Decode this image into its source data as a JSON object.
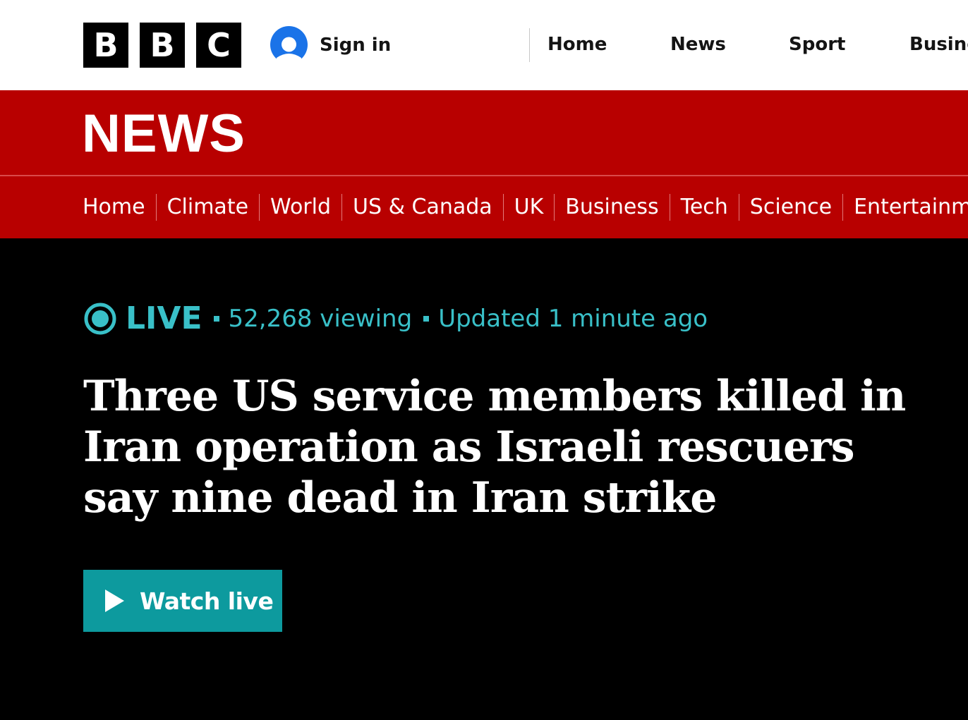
{
  "brand": {
    "logo_letters": [
      "B",
      "B",
      "C"
    ],
    "section_wordmark": "NEWS"
  },
  "account": {
    "signin_label": "Sign in",
    "icon": "user-icon"
  },
  "topnav": {
    "items": [
      "Home",
      "News",
      "Sport",
      "Busine"
    ]
  },
  "subnav": {
    "items": [
      "Home",
      "Climate",
      "World",
      "US & Canada",
      "UK",
      "Business",
      "Tech",
      "Science",
      "Entertainm"
    ]
  },
  "live": {
    "label": "LIVE",
    "viewing": "52,268 viewing",
    "updated": "Updated 1 minute ago",
    "icon": "live-indicator-icon"
  },
  "article": {
    "headline": "Three US service members killed in Iran operation as Israeli rescuers say nine dead in Iran strike"
  },
  "watch": {
    "label": "Watch live",
    "icon": "play-icon"
  },
  "colors": {
    "brand_red": "#b80000",
    "live_teal": "#39c0c8",
    "button_teal": "#0d9a9e",
    "signin_blue": "#1a73e8"
  }
}
